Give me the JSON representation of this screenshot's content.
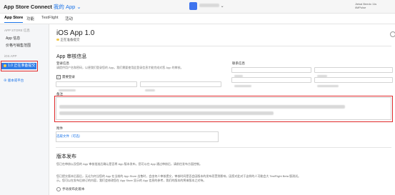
{
  "app": {
    "brand": "App Store Connect",
    "brand_sub": "我的 App ⌄",
    "user_line1": "Jiekai Beedo 11s",
    "user_line2": "iIMPulse"
  },
  "nav_tabs": [
    "App Store",
    "功能",
    "TestFlight",
    "活动"
  ],
  "sidebar": {
    "section1": "APP STORE 信息",
    "items1": [
      "App 信息",
      "价格与销售范围"
    ],
    "section2": "iOS APP",
    "active_item": "1.0 正在准备提交",
    "add_link": "⊕ 版本或平台"
  },
  "main": {
    "title": "iOS App 1.0",
    "status": "正在准备提交",
    "review_header": "App 审核信息",
    "signin_label": "登录信息",
    "signin_desc": "请提供用户名和密码，以便我们登录您的 App。我们需要使用此登录信息才能完成对您 App 的审核。",
    "signin_required": "需要登录",
    "contact_label": "联系信息",
    "notes_label": "备注",
    "attach_label": "附件",
    "attach_link": "选取文件（可选）",
    "release_header": "版本发布",
    "release_desc1": "您已在审核以及您的 App 审核批准后确认是否将 App 版本发布。您可以在 App 通过审核后，请前往发布方面控制。",
    "release_desc2": "您已提交版本后面后，无论为何当您的 App 在当前的 App Store 出售时，会由何人审核提交，审核时间是否会因版本的发布而受到影响，因您对此对于这样的人可能会大 TestFlight Beta 版测试。",
    "release_desc3": "示。您可以在发布后修订的内容，我们会修改您在 App Store 显示的 App 信息的参考，我们的版本的将来版本之对待。",
    "radio1": "手动发布此版本"
  }
}
